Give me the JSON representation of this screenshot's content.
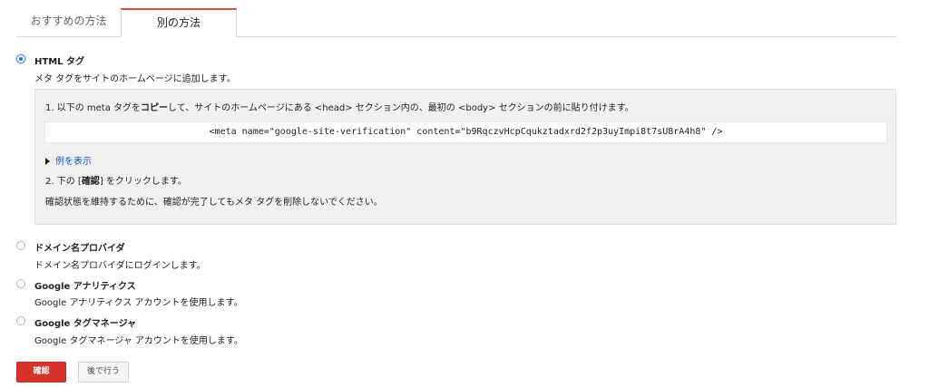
{
  "tabs": [
    "おすすめの方法",
    "別の方法"
  ],
  "html_tag": {
    "title": "HTML タグ",
    "description": "メタ タグをサイトのホームページに追加します。",
    "step1_pre": "1. 以下の meta タグを",
    "step1_copy": "コピー",
    "step1_post": "して、サイトのホームページにある <head> セクション内の、最初の <body> セクションの前に貼り付けます。",
    "meta_code": "<meta name=\"google-site-verification\" content=\"b9RqczvHcpCqukztadxrd2f2p3uyImpi8t7sU8rA4h8\" />",
    "example_link": "例を表示",
    "step2_pre": "2. 下の [",
    "step2_bold": "確認",
    "step2_post": "] をクリックします。",
    "note": "確認状態を維持するために、確認が完了してもメタ タグを削除しないでください。"
  },
  "options": [
    {
      "title": "ドメイン名プロバイダ",
      "description": "ドメイン名プロバイダにログインします。"
    },
    {
      "title": "Google アナリティクス",
      "description": "Google アナリティクス アカウントを使用します。"
    },
    {
      "title": "Google タグマネージャ",
      "description": "Google タグマネージャ アカウントを使用します。"
    }
  ],
  "buttons": {
    "confirm": "確認",
    "later": "後で行う"
  },
  "colors": {
    "accent": "#dd4b39",
    "link": "#1155cc",
    "radio_selected": "#2a6ee8"
  }
}
